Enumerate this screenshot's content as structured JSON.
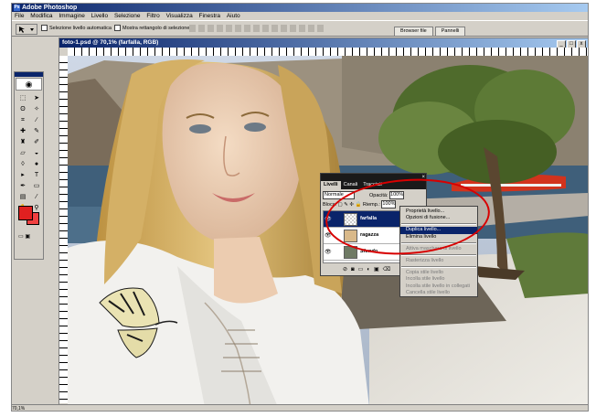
{
  "app": {
    "title": "Adobe Photoshop",
    "menu": [
      "File",
      "Modifica",
      "Immagine",
      "Livello",
      "Selezione",
      "Filtro",
      "Visualizza",
      "Finestra",
      "Aiuto"
    ]
  },
  "options_bar": {
    "auto_select": "Selezione livello automatica",
    "show_bounds": "Mostra rettangolo di selezione",
    "tabs": [
      "Browser file",
      "Pannelli"
    ]
  },
  "document": {
    "title": "foto-1.psd @ 70,1% (farfalla, RGB)",
    "window_buttons": [
      "_",
      "□",
      "x"
    ]
  },
  "layers_panel": {
    "tabs": [
      "Livelli",
      "Canali",
      "Tracciati"
    ],
    "blend_mode": "Normale",
    "opacity_label": "Opacità:",
    "opacity_value": "100%",
    "lock_label": "Blocc:",
    "fill_label": "Riemp.:",
    "fill_value": "100%",
    "layers": [
      {
        "name": "farfalla",
        "selected": true
      },
      {
        "name": "ragazza",
        "selected": false
      },
      {
        "name": "Sfondo",
        "selected": false
      }
    ]
  },
  "context_menu": {
    "items": [
      {
        "label": "Proprietà livello...",
        "enabled": true
      },
      {
        "label": "Opzioni di fusione...",
        "enabled": true
      },
      {
        "separator": true
      },
      {
        "label": "Duplica livello...",
        "enabled": true,
        "highlighted": true
      },
      {
        "label": "Elimina livello",
        "enabled": true
      },
      {
        "separator": true
      },
      {
        "label": "Attiva maschera di livello",
        "enabled": false
      },
      {
        "separator": true
      },
      {
        "label": "Rasterizza livello",
        "enabled": false
      },
      {
        "separator": true
      },
      {
        "label": "Copia stile livello",
        "enabled": false
      },
      {
        "label": "Incolla stile livello",
        "enabled": false
      },
      {
        "label": "Incolla stile livello in collegati",
        "enabled": false
      },
      {
        "label": "Cancella stile livello",
        "enabled": false
      }
    ]
  },
  "colors": {
    "title_dark": "#0a246a",
    "title_light": "#a6caf0",
    "chrome": "#d4d0c8",
    "foreground": "#e02020",
    "annotation": "#d80000"
  },
  "status": {
    "zoom": "70,1%"
  }
}
